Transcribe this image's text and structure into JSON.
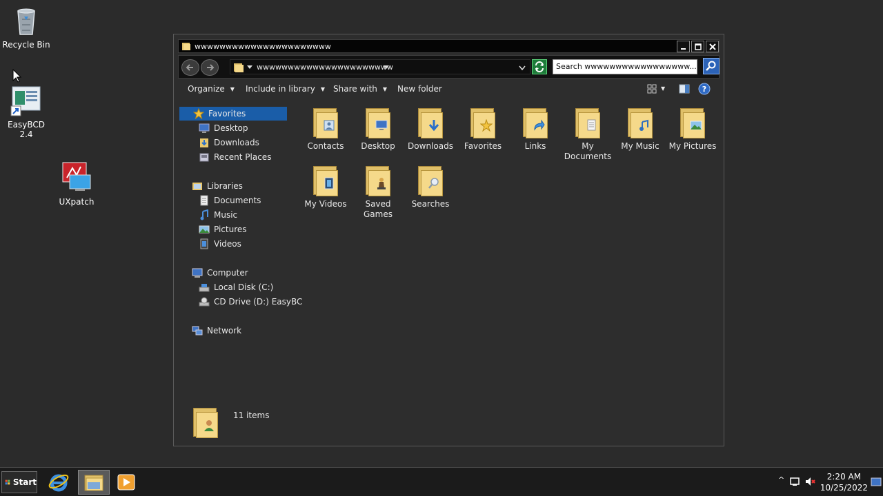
{
  "desktop": {
    "icons": [
      {
        "label": "Recycle Bin"
      },
      {
        "label": "EasyBCD 2.4"
      },
      {
        "label": "UXpatch"
      }
    ]
  },
  "window": {
    "title": "wwwwwwwwwwwwwwwwwwwwww",
    "address": "wwwwwwwwwwwwwwwwwwwwww",
    "search_value": "Search wwwwwwwwwwwwwwwww...",
    "toolbar": {
      "organize": "Organize",
      "include_in_library": "Include in library",
      "share_with": "Share with",
      "new_folder": "New folder"
    },
    "nav": {
      "favorites": "Favorites",
      "favorites_items": [
        "Desktop",
        "Downloads",
        "Recent Places"
      ],
      "libraries": "Libraries",
      "library_items": [
        "Documents",
        "Music",
        "Pictures",
        "Videos"
      ],
      "computer": "Computer",
      "computer_items": [
        "Local Disk (C:)",
        "CD Drive (D:) EasyBC"
      ],
      "network": "Network"
    },
    "folders": [
      {
        "label": "Contacts",
        "overlay": "contacts-icon"
      },
      {
        "label": "Desktop",
        "overlay": "monitor-icon"
      },
      {
        "label": "Downloads",
        "overlay": "down-arrow-icon"
      },
      {
        "label": "Favorites",
        "overlay": "star-icon"
      },
      {
        "label": "Links",
        "overlay": "link-arrow-icon"
      },
      {
        "label": "My Documents",
        "overlay": "document-icon"
      },
      {
        "label": "My Music",
        "overlay": "music-note-icon"
      },
      {
        "label": "My Pictures",
        "overlay": "landscape-icon"
      },
      {
        "label": "My Videos",
        "overlay": "film-icon"
      },
      {
        "label": "Saved Games",
        "overlay": "chess-piece-icon"
      },
      {
        "label": "Searches",
        "overlay": "magnifier-icon"
      }
    ],
    "details": {
      "count": "11 items"
    }
  },
  "taskbar": {
    "start_label": "Start",
    "time": "2:20 AM",
    "date": "10/25/2022"
  },
  "colors": {
    "desktop_bg": "#2b2b2b",
    "selection": "#1a5da8",
    "folder": "#f5d98a"
  }
}
